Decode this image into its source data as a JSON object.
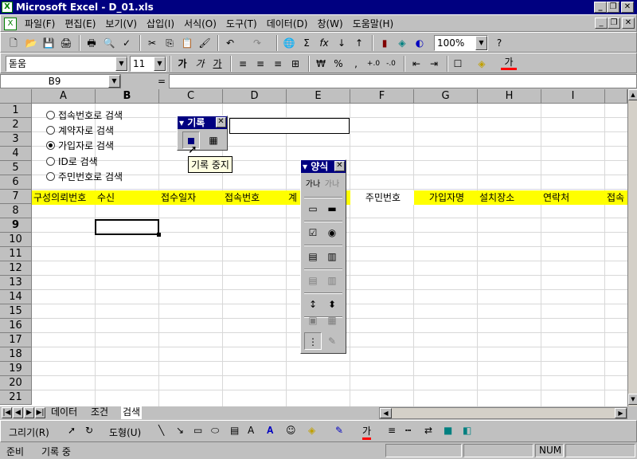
{
  "window": {
    "title": "Microsoft Excel - D_01.xls",
    "controls": [
      "_",
      "❐",
      "✕"
    ]
  },
  "menu": {
    "items": [
      "파일(F)",
      "편집(E)",
      "보기(V)",
      "삽입(I)",
      "서식(O)",
      "도구(T)",
      "데이터(D)",
      "창(W)",
      "도움말(H)"
    ]
  },
  "standard_toolbar": {
    "zoom": "100%"
  },
  "format_toolbar": {
    "font": "돋움",
    "size": "11",
    "bold": "가",
    "italic": "가",
    "underline": "가",
    "currency": "₩",
    "percent": "%",
    "comma": ",",
    "font_color_label": "가"
  },
  "formula_bar": {
    "name_box": "B9",
    "equals": "=",
    "value": ""
  },
  "columns": [
    "A",
    "B",
    "C",
    "D",
    "E",
    "F",
    "G",
    "H",
    "I"
  ],
  "rows": [
    "1",
    "2",
    "3",
    "4",
    "5",
    "6",
    "7",
    "8",
    "9",
    "10",
    "11",
    "12",
    "13",
    "14",
    "15",
    "16",
    "17",
    "18",
    "19",
    "20",
    "21"
  ],
  "radio_options": [
    {
      "label": "접속번호로 검색",
      "checked": false
    },
    {
      "label": "계약자로 검색",
      "checked": false
    },
    {
      "label": "가입자로 검색",
      "checked": true
    },
    {
      "label": "ID로 검색",
      "checked": false
    },
    {
      "label": "주민번호로 검색",
      "checked": false
    }
  ],
  "header_row": {
    "a": "구성의뢰번호",
    "b": "수신",
    "c": "접수일자",
    "d": "접속번호",
    "e": "계",
    "f": "주민번호",
    "g": "가입자명",
    "h": "설치장소",
    "i": "연락처",
    "j": "접속"
  },
  "record_toolbar": {
    "title": "기록",
    "tooltip": "기록 중지"
  },
  "forms_toolbar": {
    "title": "양식",
    "label_btn": "가나",
    "group_btn": "가나"
  },
  "sheet_tabs": [
    "데이터",
    "조건",
    "검색"
  ],
  "active_sheet": "검색",
  "draw_toolbar": {
    "draw": "그리기(R)",
    "autoshapes": "도형(U)",
    "font_color_label": "가"
  },
  "status_bar": {
    "ready": "준비",
    "recording": "기록 중",
    "num": "NUM"
  }
}
